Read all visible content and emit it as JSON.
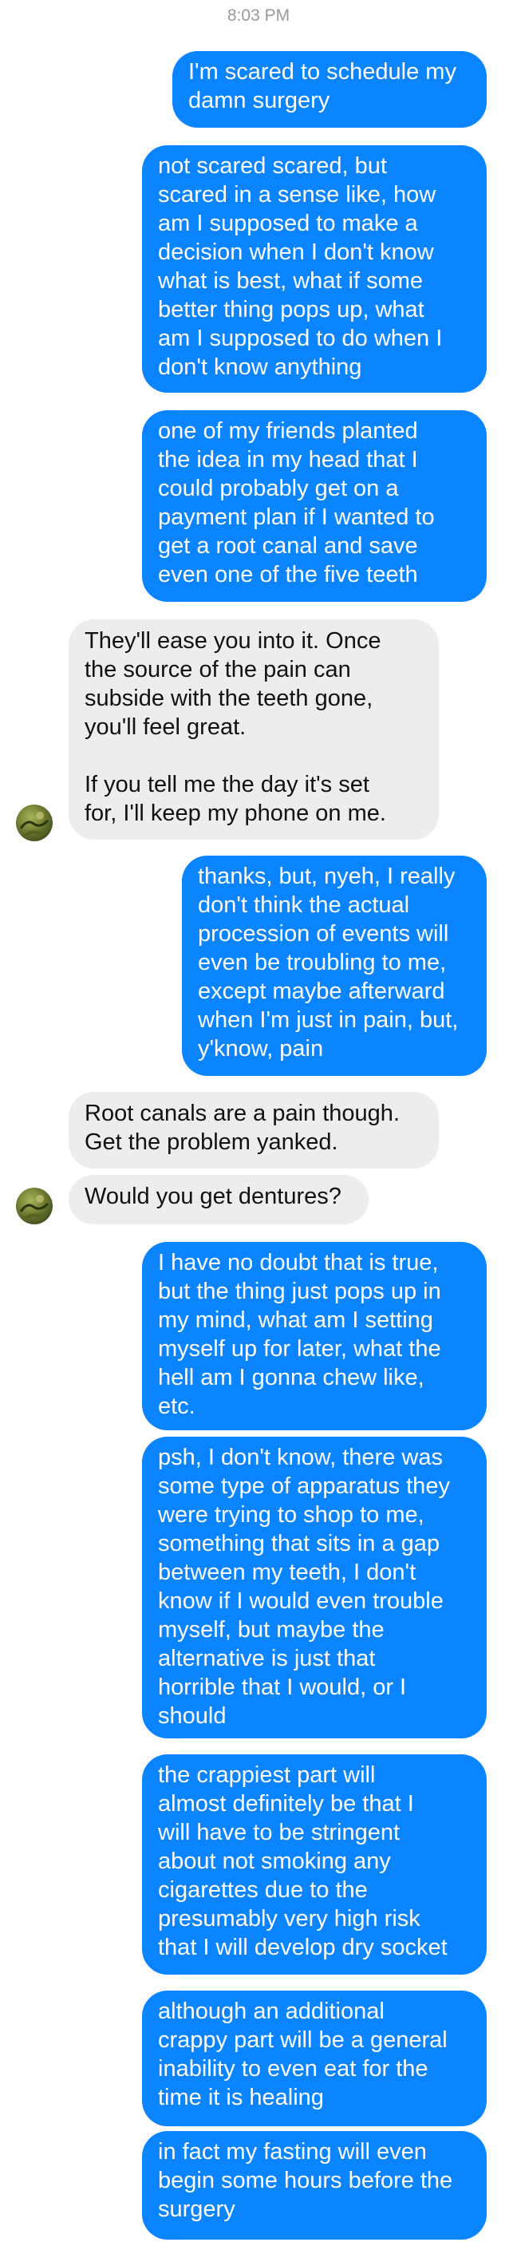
{
  "timestamp": "8:03 PM",
  "messages": [
    {
      "sender": "me",
      "text": "I'm scared to schedule my\ndamn surgery"
    },
    {
      "sender": "me",
      "text": "not scared scared, but\nscared in a sense like, how\nam I supposed to make a\ndecision when I don't know\nwhat is best, what if some\nbetter thing pops up, what\nam I supposed to do when I\ndon't know anything"
    },
    {
      "sender": "me",
      "text": "one of my friends planted\nthe idea in my head that I\ncould probably get on a\npayment plan if I wanted to\nget a root canal and save\neven one of the five teeth"
    },
    {
      "sender": "them",
      "text": "They'll ease you into it. Once\nthe source of the pain can\nsubside with the teeth gone,\nyou'll feel great.\n\nIf you tell me the day it's set\nfor, I'll keep my phone on me."
    },
    {
      "sender": "me",
      "text": "thanks, but, nyeh, I really\ndon't think the actual\nprocession of events will\neven be troubling to me,\nexcept maybe afterward\nwhen I'm just in pain, but,\ny'know, pain"
    },
    {
      "sender": "them",
      "text": "Root canals are a pain though.\nGet the problem yanked."
    },
    {
      "sender": "them",
      "text": "Would you get dentures?"
    },
    {
      "sender": "me",
      "text": "I have no doubt that is true,\nbut the thing just pops up in\nmy mind, what am I setting\nmyself up for later, what the\nhell am I gonna chew like,\netc."
    },
    {
      "sender": "me",
      "text": "psh, I don't know, there was\nsome type of apparatus they\nwere trying to shop to me,\nsomething that sits in a gap\nbetween my teeth, I don't\nknow if I would even trouble\nmyself, but maybe the\nalternative is just that\nhorrible that I would, or I\nshould"
    },
    {
      "sender": "me",
      "text": "the crappiest part will\nalmost definitely be that I\nwill have to be stringent\nabout not smoking any\ncigarettes due to the\npresumably very high risk\nthat I will develop dry socket"
    },
    {
      "sender": "me",
      "text": "although an additional\ncrappy part will be a general\ninability to even eat for the\ntime it is healing"
    },
    {
      "sender": "me",
      "text": "in fact my fasting will even\nbegin some hours before the\nsurgery"
    }
  ],
  "colors": {
    "outgoing_bubble": "#0a84ff",
    "incoming_bubble": "#ededed",
    "timestamp": "#9a9a9a"
  }
}
